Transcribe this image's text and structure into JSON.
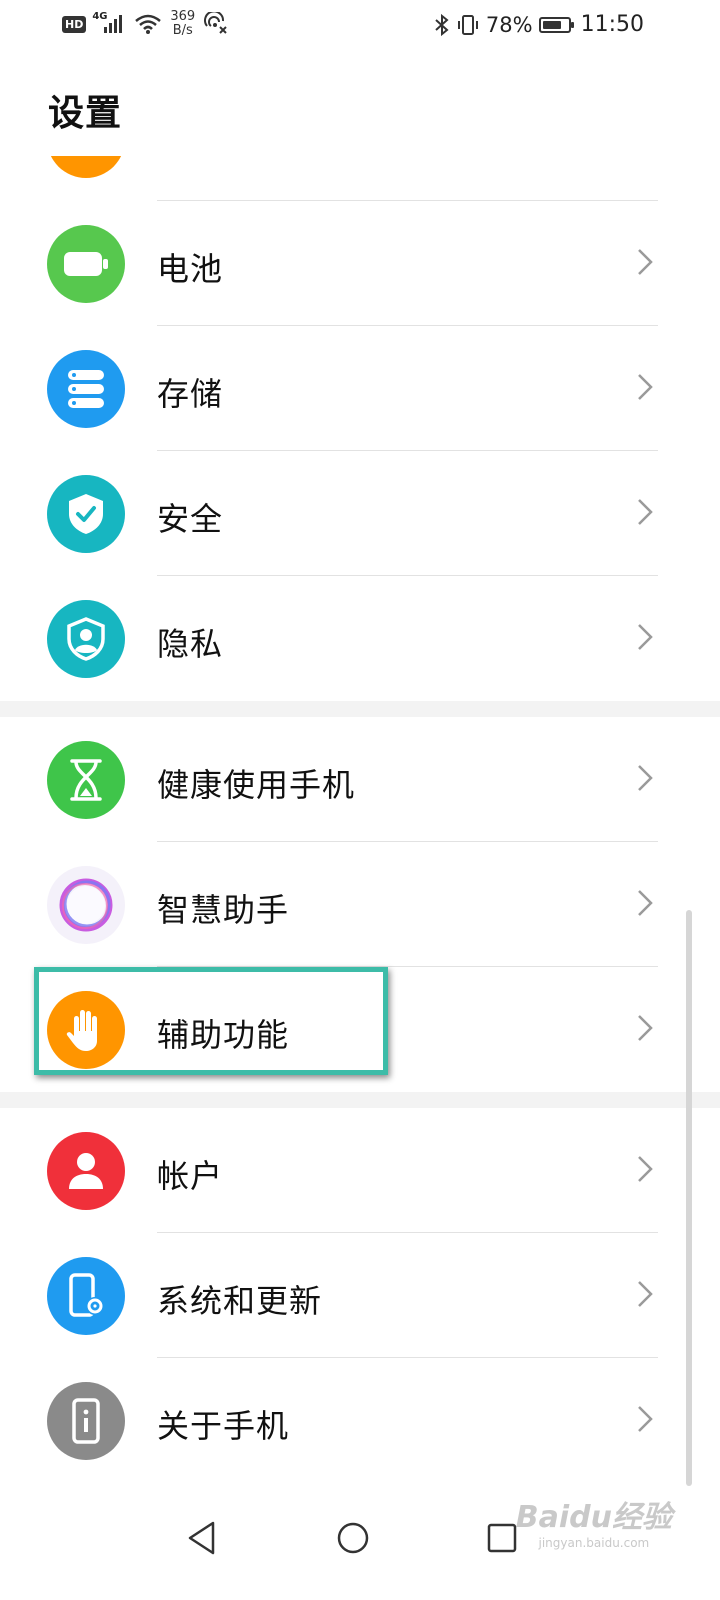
{
  "status_bar": {
    "hd": "HD",
    "network": "4G",
    "speed_value": "369",
    "speed_unit": "B/s",
    "battery_percent": "78%",
    "battery_level": 0.78,
    "time": "11:50"
  },
  "page": {
    "title": "设置"
  },
  "sections": [
    {
      "items": [
        {
          "label": "电池",
          "icon": "battery-icon",
          "color": "#57c84e"
        },
        {
          "label": "存储",
          "icon": "storage-icon",
          "color": "#1f9bf0"
        },
        {
          "label": "安全",
          "icon": "shield-check-icon",
          "color": "#17b6c1"
        },
        {
          "label": "隐私",
          "icon": "privacy-shield-icon",
          "color": "#17b6c1"
        }
      ]
    },
    {
      "items": [
        {
          "label": "健康使用手机",
          "icon": "hourglass-icon",
          "color": "#3fc54a"
        },
        {
          "label": "智慧助手",
          "icon": "assistant-ring-icon",
          "color": "#f4f1fa"
        },
        {
          "label": "辅助功能",
          "icon": "hand-icon",
          "color": "#ff9500"
        }
      ]
    },
    {
      "items": [
        {
          "label": "帐户",
          "icon": "account-icon",
          "color": "#f0303a"
        },
        {
          "label": "系统和更新",
          "icon": "phone-settings-icon",
          "color": "#1f9bf0"
        },
        {
          "label": "关于手机",
          "icon": "phone-info-icon",
          "color": "#8a8a8a"
        }
      ]
    }
  ],
  "partial_top_icon_color": "#ff9500",
  "highlight_color": "#3dbca8",
  "navigation": {
    "back": "back-icon",
    "home": "home-icon",
    "recents": "recents-icon"
  },
  "watermark": {
    "main": "Baidu经验",
    "sub": "jingyan.baidu.com"
  }
}
